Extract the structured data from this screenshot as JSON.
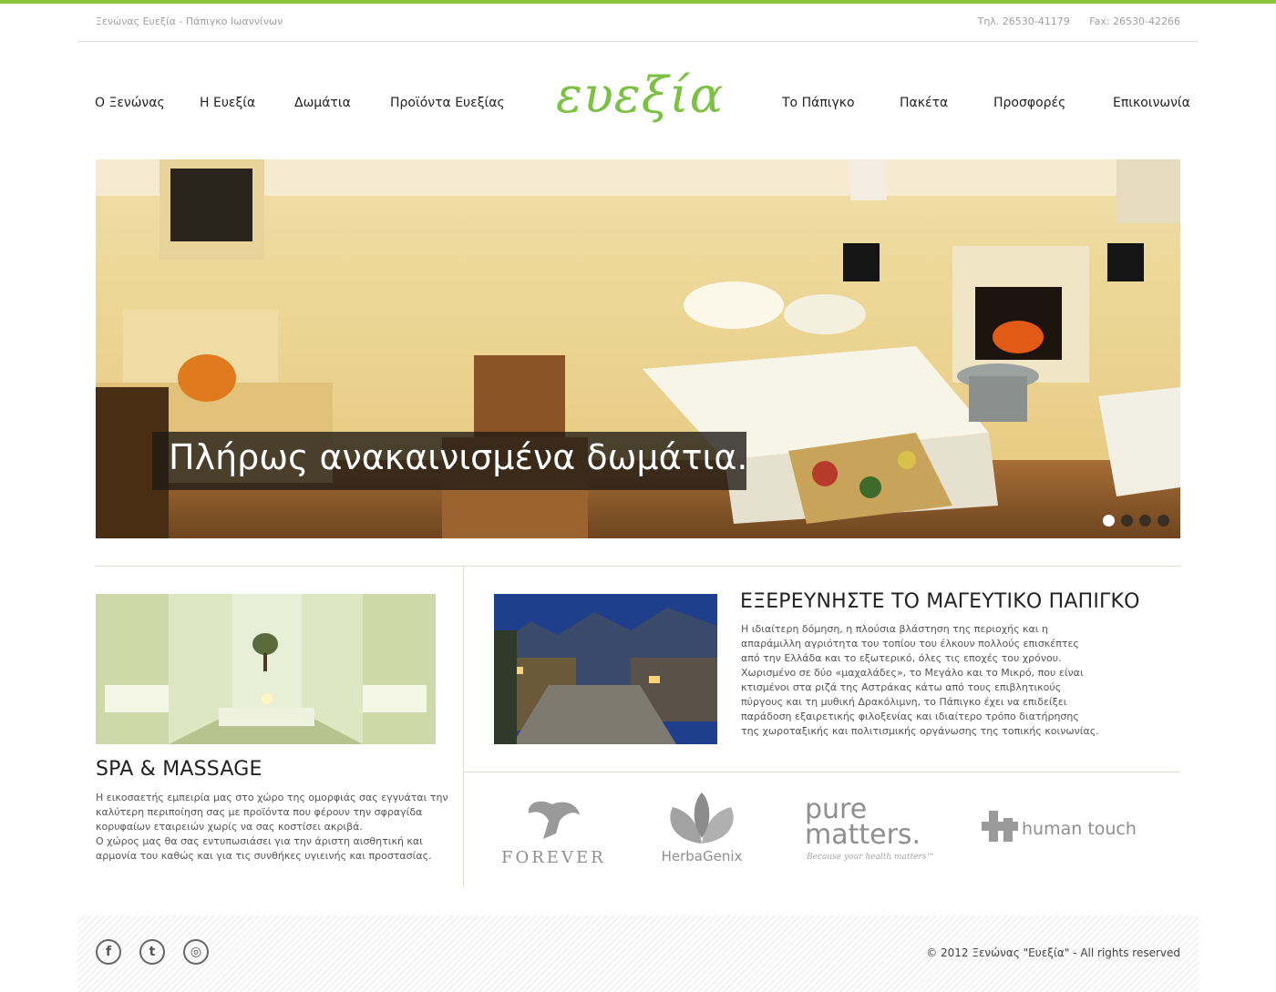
{
  "colors": {
    "accent": "#8cc63f",
    "logo": "#7cc142"
  },
  "top": {
    "tagline": "Ξενώνας Ευεξία - Πάπιγκο Ιωαννίνων",
    "phone": "Τηλ. 26530-41179",
    "fax": "Fax: 26530-42266"
  },
  "nav": {
    "left": [
      "Ο Ξενώνας",
      "Η Ευεξία",
      "Δωμάτια",
      "Προϊόντα Ευεξίας"
    ],
    "right": [
      "Το Πάπιγκο",
      "Πακέτα",
      "Προσφορές",
      "Επικοινωνία"
    ]
  },
  "logo": {
    "text": "ευεξία"
  },
  "hero": {
    "caption": "Πλήρως ανακαινισμένα δωμάτια.",
    "slides_total": 4,
    "active_slide": 1
  },
  "spa": {
    "title": "SPA & MASSAGE",
    "lines": [
      "Η εικοσαετής εμπειρία μας στο χώρο της ομορφιάς σας εγγυάται την",
      "καλύτερη περιποίηση σας με προϊόντα που φέρουν την σφραγίδα",
      "κορυφαίων εταιρειών χωρίς να σας κοστίσει ακριβά.",
      "Ο χώρος μας θα σας εντυπωσιάσει για την άριστη αισθητική και",
      "αρμονία του καθώς και για τις συνθήκες υγιεινής και προστασίας."
    ]
  },
  "papigko": {
    "title": "ΕΞΕΡΕΥΝΗΣΤΕ ΤΟ ΜΑΓΕΥΤΙΚΟ ΠΑΠΙΓΚΟ",
    "lines": [
      "Η ιδιαίτερη δόμηση, η πλούσια βλάστηση της περιοχής και η",
      "απαράμιλλη αγριότητα του τοπίου του έλκουν πολλούς επισκέπτες",
      "από την Ελλάδα και το εξωτερικό, όλες τις εποχές του χρόνου.",
      "Χωρισμένο σε δύο «μαχαλάδες», το Μεγάλο και το Μικρό, που είναι",
      "κτισμένοι στα ριζά της Αστράκας κάτω από τους επιβλητικούς",
      "πύργους και τη μυθική Δρακόλιμνη, το Πάπιγκο έχει να επιδείξει",
      "παράδοση εξαιρετικής φιλοξενίας και ιδιαίτερο τρόπο διατήρησης",
      "της χωροταξικής και πολιτισμικής οργάνωσης της τοπικής κοινωνίας."
    ]
  },
  "brands": {
    "forever": "FOREVER",
    "herbagenix": "HerbaGenix",
    "pure1": "pure",
    "pure2": "matters.",
    "pure_tag": "Because your health matters™",
    "humantouch": "human touch"
  },
  "footer": {
    "social": [
      {
        "icon": "facebook-icon",
        "glyph": "f"
      },
      {
        "icon": "twitter-icon",
        "glyph": "t"
      },
      {
        "icon": "instagram-icon",
        "glyph": "◎"
      }
    ],
    "copyright": "© 2012 Ξενώνας \"Ευεξία\" - All rights reserved"
  }
}
